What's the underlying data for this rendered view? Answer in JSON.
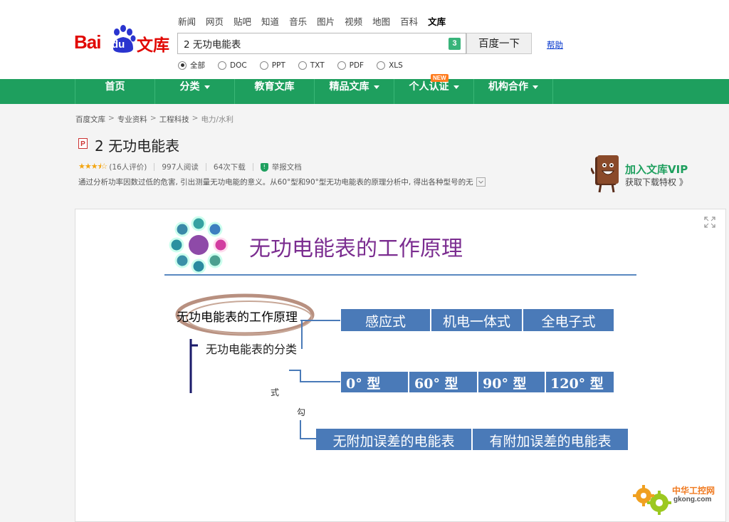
{
  "header": {
    "logo_bai": "Bai",
    "logo_du": "du",
    "logo_wenku": "文库",
    "topnav": [
      "新闻",
      "网页",
      "贴吧",
      "知道",
      "音乐",
      "图片",
      "视频",
      "地图",
      "百科",
      "文库"
    ],
    "search_value": "2 无功电能表",
    "keyboard_badge": "3",
    "search_button": "百度一下",
    "help_link": "帮助",
    "filters": [
      "全部",
      "DOC",
      "PPT",
      "TXT",
      "PDF",
      "XLS"
    ]
  },
  "greennav": {
    "items": [
      "首页",
      "分类",
      "教育文库",
      "精品文库",
      "个人认证",
      "机构合作"
    ],
    "new_badge": "NEW"
  },
  "breadcrumb": [
    "百度文库",
    "专业资料",
    "工程科技",
    "电力/水利"
  ],
  "doc": {
    "type_badge": "P",
    "title": "2  无功电能表",
    "rating_text": "(16人评价)",
    "rating_value": 3.5,
    "reads": "997人阅读",
    "downloads": "64次下载",
    "report": "举报文档",
    "summary": "通过分析功率因数过低的危害, 引出测量无功电能的意义。从60°型和90°型无功电能表的原理分析中, 得出各种型号的无"
  },
  "vip": {
    "title": "加入文库VIP",
    "subtitle": "获取下载特权 》"
  },
  "slide": {
    "title": "无功电能表的工作原理",
    "main_label": "无功电能表的工作原理",
    "sub_label": "无功电能表的分类",
    "row1": [
      "感应式",
      "机电一体式",
      "全电子式"
    ],
    "row2": [
      "0°  型",
      "60°  型",
      "90°  型",
      "120°  型"
    ],
    "row3": [
      "无附加误差的电能表",
      "有附加误差的电能表"
    ],
    "stray1": "式",
    "stray2": "勾"
  },
  "watermark": {
    "brand": "中华工控网",
    "url": "gkong.com"
  },
  "colors": {
    "brand_red": "#e10601",
    "green_bar": "#1e9f5e",
    "slide_blue": "#4a7ab8",
    "slide_title": "#7b2d90"
  }
}
